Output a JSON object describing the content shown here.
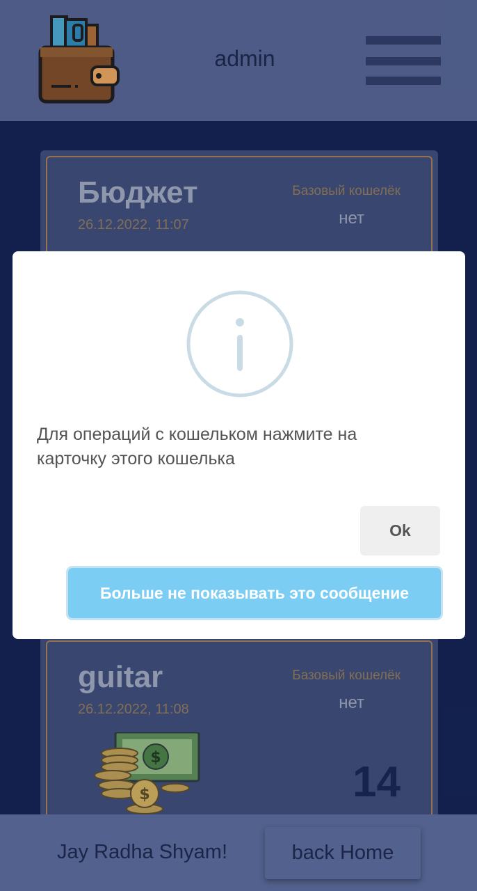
{
  "header": {
    "username": "admin",
    "logo_icon": "wallet-icon",
    "menu_icon": "hamburger-menu-icon"
  },
  "wallets": [
    {
      "name": "Бюджет",
      "date": "26.12.2022, 11:07",
      "base_label": "Базовый кошелёк",
      "base_value": "нет",
      "count": ""
    },
    {
      "name": "guitar",
      "date": "26.12.2022, 11:08",
      "base_label": "Базовый кошелёк",
      "base_value": "нет",
      "count": "14"
    }
  ],
  "modal": {
    "icon": "info-icon",
    "message": "Для операций с кошельком нажмите на карточку этого кошелька",
    "ok_label": "Ok",
    "dont_show_label": "Больше не показывать это сообщение"
  },
  "footer": {
    "greeting": "Jay Radha Shyam!",
    "home_label": "back Home"
  },
  "colors": {
    "header_bg": "#52618d",
    "page_bg": "#13214f",
    "card_bg": "#3c4a73",
    "card_border": "#a17b52",
    "primary_button": "#7ccdf4"
  }
}
